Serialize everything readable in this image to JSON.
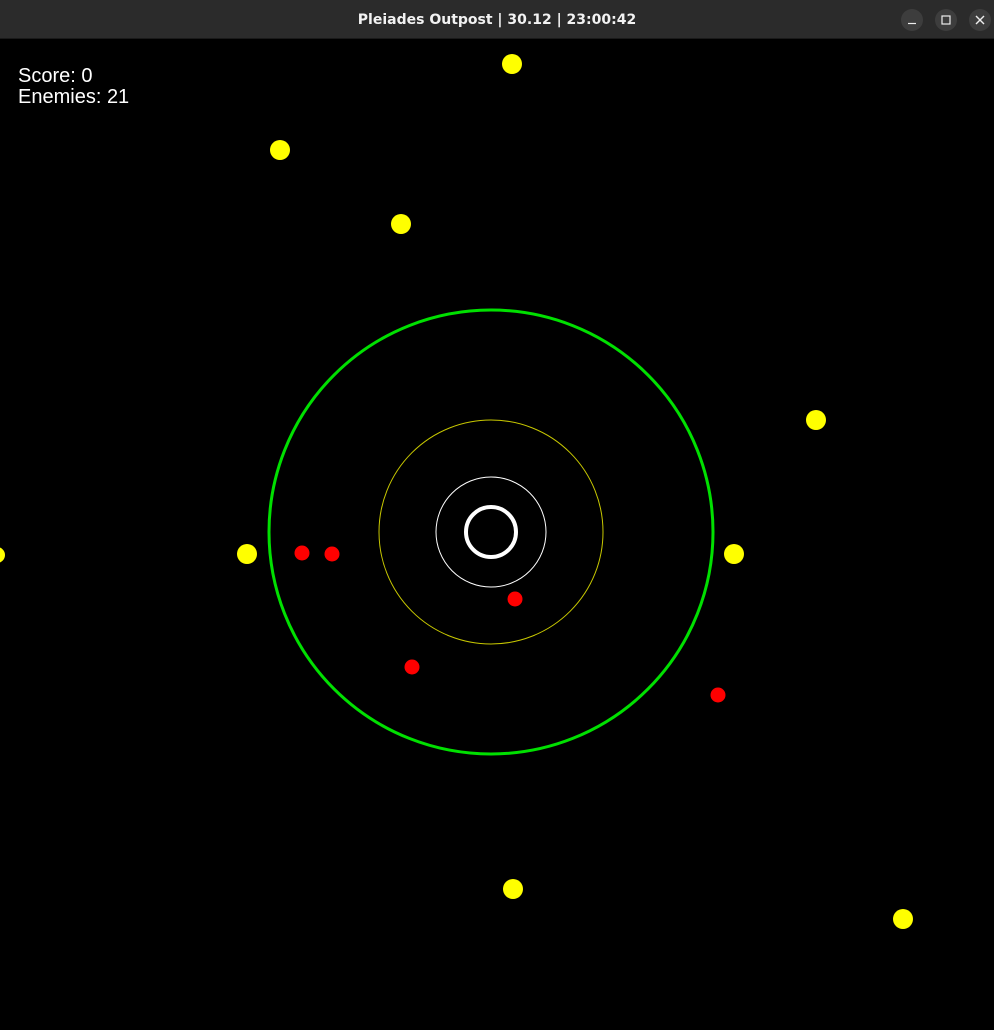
{
  "window": {
    "title": "Pleiades Outpost | 30.12 | 23:00:42",
    "buttons": [
      "minimize-icon",
      "maximize-icon",
      "close-icon"
    ]
  },
  "hud": {
    "score_label": "Score:",
    "score_value": "0",
    "enemies_label": "Enemies:",
    "enemies_value": "21"
  },
  "colors": {
    "background": "#000000",
    "defense_ring": "#00e000",
    "inner_yellow_ring": "#c8c800",
    "inner_white_ring": "#ffffff",
    "core": "#ffffff",
    "friendly_unit": "#ffff00",
    "enemy": "#ff0000"
  }
}
